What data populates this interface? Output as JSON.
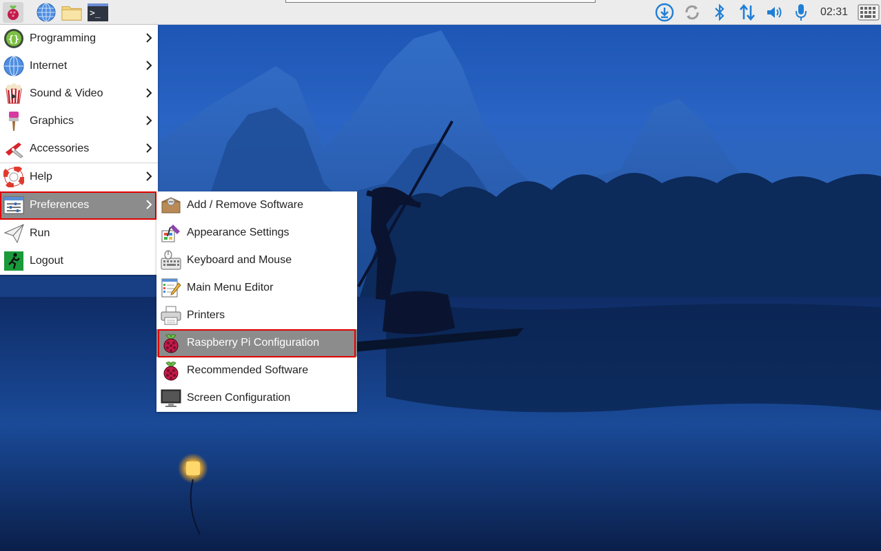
{
  "taskbar": {
    "menu_button": "raspberry-menu",
    "launchers": [
      "web-browser-icon",
      "file-manager-icon",
      "terminal-icon"
    ],
    "terminal_glyph": ">_",
    "clock": "02:31",
    "colors": {
      "tray_blue": "#1f7fd6",
      "tray_grey": "#9a9a9a"
    }
  },
  "main_menu": {
    "items": [
      {
        "label": "Programming",
        "icon": "programming-icon",
        "has_submenu": true
      },
      {
        "label": "Internet",
        "icon": "internet-globe-icon",
        "has_submenu": true
      },
      {
        "label": "Sound & Video",
        "icon": "sound-video-icon",
        "has_submenu": true
      },
      {
        "label": "Graphics",
        "icon": "graphics-brush-icon",
        "has_submenu": true
      },
      {
        "label": "Accessories",
        "icon": "accessories-knife-icon",
        "has_submenu": true
      },
      {
        "label": "Help",
        "icon": "help-lifebuoy-icon",
        "has_submenu": true
      },
      {
        "label": "Preferences",
        "icon": "preferences-icon",
        "has_submenu": true,
        "highlighted": true
      },
      {
        "label": "Run",
        "icon": "run-paperplane-icon",
        "has_submenu": false
      },
      {
        "label": "Logout",
        "icon": "logout-icon",
        "has_submenu": false
      }
    ]
  },
  "preferences_submenu": {
    "items": [
      {
        "label": "Add / Remove Software",
        "icon": "package-box-icon"
      },
      {
        "label": "Appearance Settings",
        "icon": "appearance-icon"
      },
      {
        "label": "Keyboard and Mouse",
        "icon": "keyboard-mouse-icon"
      },
      {
        "label": "Main Menu Editor",
        "icon": "menu-editor-icon"
      },
      {
        "label": "Printers",
        "icon": "printer-icon"
      },
      {
        "label": "Raspberry Pi Configuration",
        "icon": "raspberry-icon",
        "highlighted": true
      },
      {
        "label": "Recommended Software",
        "icon": "raspberry-icon"
      },
      {
        "label": "Screen Configuration",
        "icon": "monitor-icon"
      }
    ]
  },
  "colors": {
    "highlight_bg": "#8c8c8c",
    "annotation_frame": "#e00000",
    "raspberry_red": "#c51a4a",
    "raspberry_leaf": "#6cc04a"
  }
}
